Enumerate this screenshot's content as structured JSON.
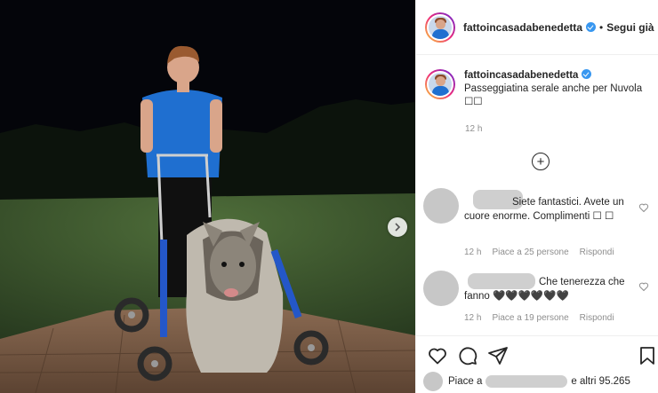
{
  "post": {
    "username": "fattoincasadabenedetta",
    "follow_separator": "•",
    "follow_label": "Segui già",
    "caption_text": "Passeggiatina serale anche per Nuvola",
    "caption_emoji": "☐☐",
    "caption_time": "12 h"
  },
  "comments": [
    {
      "text": "Siete fantastici. Avete un cuore enorme. Complimenti ☐ ☐",
      "time": "12 h",
      "likes": "Piace a 25 persone",
      "reply": "Rispondi"
    },
    {
      "text": "Che tenerezza che fanno 🖤🖤🖤🖤🖤🖤",
      "time": "12 h",
      "likes": "Piace a 19 persone",
      "reply": "Rispondi"
    }
  ],
  "likes_bar": {
    "prefix": "Piace a",
    "suffix": "e altri 95.265"
  },
  "icons": {
    "verified": "verified-badge-icon",
    "load_more": "plus-circle-icon",
    "next": "chevron-right-icon",
    "like": "heart-icon",
    "comment": "comment-bubble-icon",
    "share": "paper-plane-icon",
    "save": "bookmark-icon"
  },
  "colors": {
    "verified_blue": "#3897f0",
    "shirt_blue": "#1f6fd0",
    "secondary_text": "#8e8e8e"
  }
}
